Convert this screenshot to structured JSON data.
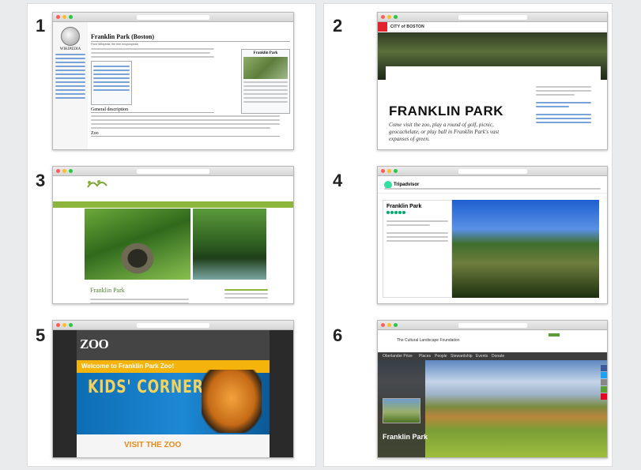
{
  "panels": [
    {
      "number": "1",
      "site": "wikipedia",
      "title": "Franklin Park (Boston)",
      "subtitle": "From Wikipedia, the free encyclopedia",
      "infobox_title": "Franklin Park",
      "section_heading": "General description",
      "section_heading_2": "Zoo"
    },
    {
      "number": "2",
      "site": "city-of-boston",
      "logo": "CITY of BOSTON",
      "title": "FRANKLIN PARK",
      "description": "Come visit the zoo, play a round of golf, picnic, geocachelate, or play ball in Franklin Park's vast expanses of green."
    },
    {
      "number": "3",
      "site": "emerald-necklace",
      "title": "Franklin Park"
    },
    {
      "number": "4",
      "site": "tripadvisor",
      "brand": "Tripadvisor",
      "title": "Franklin Park"
    },
    {
      "number": "5",
      "site": "zoo-new-england",
      "logo": "ZOO",
      "welcome": "Welcome to Franklin Park Zoo!",
      "hero_text": "KIDS' CORNER",
      "visit_text": "VISIT THE ZOO"
    },
    {
      "number": "6",
      "site": "cultural-landscape-foundation",
      "brand": "The Cultural Landscape Foundation",
      "nav": [
        "Oberlander Prize",
        "Places",
        "People",
        "Stewardship",
        "Events",
        "Donate"
      ],
      "title": "Franklin Park"
    }
  ],
  "colors": {
    "background": "#e9ebec",
    "boston_red": "#e1232d",
    "tripadvisor_green": "#34e0a1",
    "zoo_yellow": "#f5b40b",
    "emerald_green": "#8bb53b"
  }
}
